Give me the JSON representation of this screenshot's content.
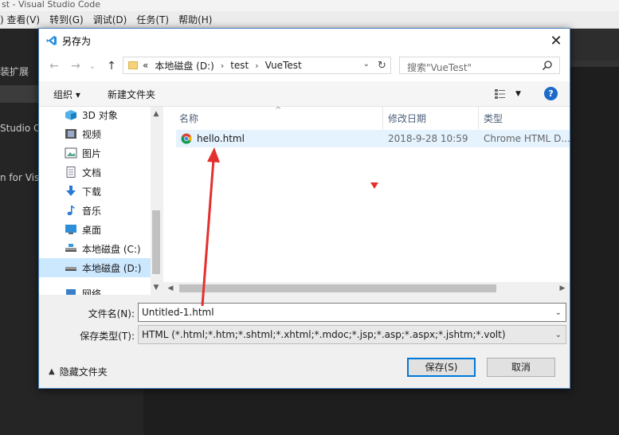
{
  "app": {
    "title": "st - Visual Studio Code",
    "menu": [
      ") 查看(V)",
      "转到(G)",
      "调试(D)",
      "任务(T)",
      "帮助(H)"
    ],
    "left_texts": [
      "装扩展",
      "Studio C",
      "n for Vis"
    ]
  },
  "dialog": {
    "title": "另存为",
    "close": "✕",
    "nav": {
      "back": "←",
      "forward": "→",
      "recent": "⌄",
      "up": "↑"
    },
    "breadcrumb": [
      "«",
      "本地磁盘 (D:)",
      "test",
      "VueTest"
    ],
    "search_placeholder": "搜索\"VueTest\"",
    "toolbar": {
      "organize": "组织 ▾",
      "new_folder": "新建文件夹"
    },
    "tree": [
      {
        "label": "3D 对象",
        "icon": "3d-objects-icon"
      },
      {
        "label": "视频",
        "icon": "video-icon"
      },
      {
        "label": "图片",
        "icon": "pictures-icon"
      },
      {
        "label": "文档",
        "icon": "documents-icon"
      },
      {
        "label": "下载",
        "icon": "download-icon"
      },
      {
        "label": "音乐",
        "icon": "music-icon"
      },
      {
        "label": "桌面",
        "icon": "desktop-icon"
      },
      {
        "label": "本地磁盘 (C:)",
        "icon": "drive-icon"
      },
      {
        "label": "本地磁盘 (D:)",
        "icon": "drive-icon",
        "selected": true
      },
      {
        "label": "网络",
        "icon": "network-icon"
      }
    ],
    "columns": {
      "name": "名称",
      "modified": "修改日期",
      "type": "类型"
    },
    "files": [
      {
        "name": "hello.html",
        "modified": "2018-9-28 10:59",
        "type": "Chrome HTML D..."
      }
    ],
    "filename_label": "文件名(N):",
    "filename_value": "Untitled-1.html",
    "filetype_label": "保存类型(T):",
    "filetype_value": "HTML (*.html;*.htm;*.shtml;*.xhtml;*.mdoc;*.jsp;*.asp;*.aspx;*.jshtm;*.volt)",
    "hide_folders": "隐藏文件夹",
    "save_button": "保存(S)",
    "cancel_button": "取消"
  }
}
